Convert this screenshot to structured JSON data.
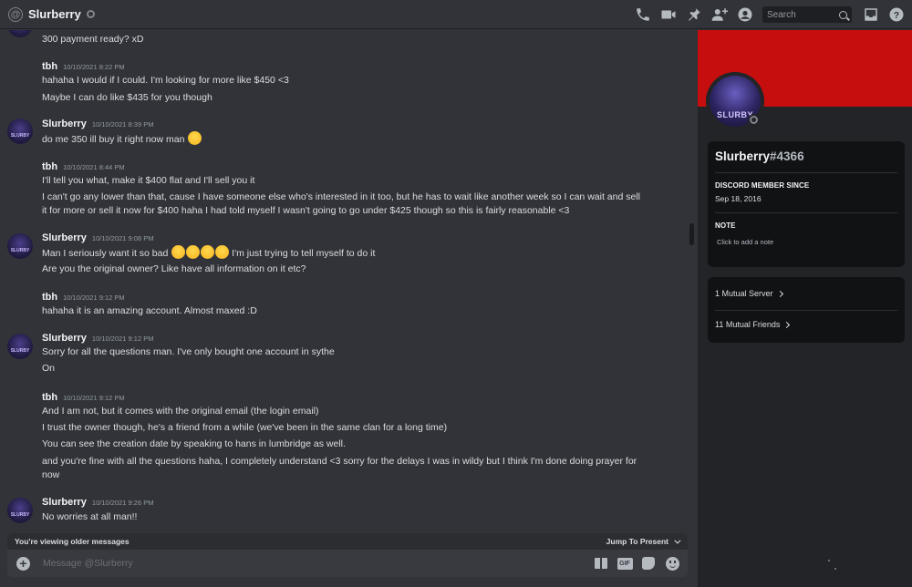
{
  "header": {
    "title": "Slurberry",
    "search_placeholder": "Search"
  },
  "messages": [
    {
      "lines": [
        "300 payment ready? xD"
      ]
    },
    {
      "author": "tbh",
      "time": "10/10/2021 8:22 PM",
      "lines": [
        "hahaha I would if I could. I'm looking for more like $450 <3",
        "Maybe I can do like $435 for you though"
      ]
    },
    {
      "author": "Slurberry",
      "time": "10/10/2021 8:39 PM",
      "lines": [
        "do me 350 ill buy it right now man"
      ]
    },
    {
      "author": "tbh",
      "time": "10/10/2021 8:44 PM",
      "lines": [
        "I'll tell you what, make it $400 flat and I'll sell you it",
        "I can't go any lower than that, cause I have someone else who's interested in it too, but he has to wait like another week so I can wait and sell",
        "it for more or sell it now for $400 haha I had told myself I wasn't going to go under $425 though so this is fairly reasonable <3"
      ]
    },
    {
      "author": "Slurberry",
      "time": "10/10/2021 9:08 PM",
      "lines": [
        "Man I seriously want it so bad",
        "I'm just trying to tell myself to do it",
        "Are you the original owner? Like have all information on it etc?"
      ]
    },
    {
      "author": "tbh",
      "time": "10/10/2021 9:12 PM",
      "lines": [
        "hahaha it is an amazing account. Almost maxed :D"
      ]
    },
    {
      "author": "Slurberry",
      "time": "10/10/2021 9:12 PM",
      "lines": [
        "Sorry for all the questions man. I've only bought one account in sythe",
        "On"
      ]
    },
    {
      "author": "tbh",
      "time": "10/10/2021 9:12 PM",
      "lines": [
        "And I am not, but it comes with the original email (the login email)",
        "I trust the owner though, he's a friend from a while (we've been in the same clan for a long time)",
        "You can see the creation date by speaking to hans in lumbridge as well.",
        "and you're fine with all the questions haha, I completely understand <3 sorry for the delays I was in wildy but I think I'm done doing prayer for",
        "now"
      ]
    },
    {
      "author": "Slurberry",
      "time": "10/10/2021 9:26 PM",
      "lines": [
        "No worries at all man!!"
      ]
    }
  ],
  "older_bar": {
    "text": "You're viewing older messages",
    "jump": "Jump To Present"
  },
  "composer": {
    "placeholder": "Message @Slurberry",
    "gif_label": "GIF"
  },
  "profile": {
    "avatar_text": "SLURBY",
    "name": "Slurberry",
    "discriminator": "#4366",
    "member_since_title": "DISCORD MEMBER SINCE",
    "member_since": "Sep 18, 2016",
    "note_title": "NOTE",
    "note_placeholder": "Click to add a note",
    "mutual_servers": "1 Mutual Server",
    "mutual_friends": "11 Mutual Friends"
  },
  "avatar_small_text": "SLURBY",
  "colors": {
    "banner": "#c70e0e",
    "background": "#313338",
    "panel": "#232428",
    "card": "#111214"
  },
  "icons": [
    "at-icon",
    "phone-call-icon",
    "video-icon",
    "pin-icon",
    "add-friend-icon",
    "profile-toggle-icon",
    "search-icon",
    "inbox-icon",
    "help-icon",
    "add-attachment-icon",
    "gift-icon",
    "gif-icon",
    "sticker-icon",
    "emoji-icon"
  ]
}
